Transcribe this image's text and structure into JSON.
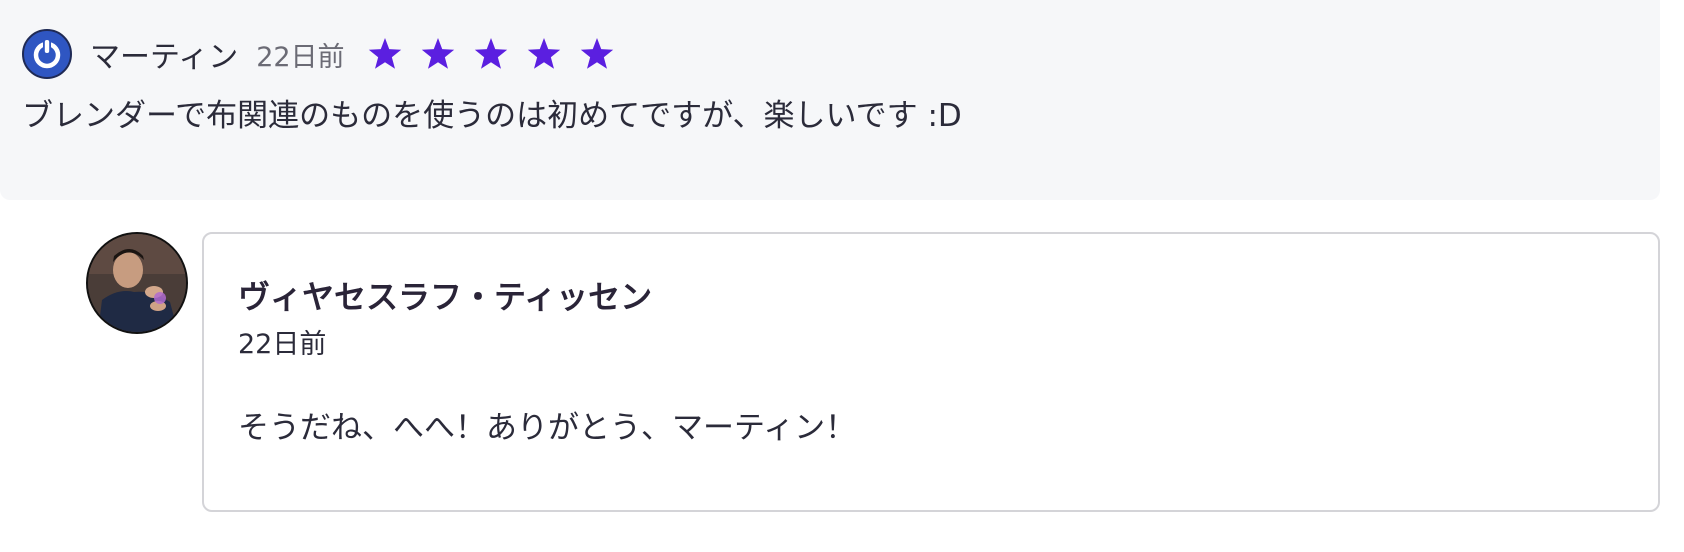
{
  "review": {
    "reviewer_name": "マーティン",
    "date": "22日前",
    "rating": 5,
    "rating_max": 5,
    "star_color": "#5b1fe0",
    "text": "ブレンダーで布関連のものを使うのは初めてですが、楽しいです :D",
    "avatar_icon": "power-logo-icon"
  },
  "reply": {
    "author": "ヴィヤセスラフ・ティッセン",
    "date": "22日前",
    "text": "そうだね、へへ！ありがとう、マーティン！"
  }
}
